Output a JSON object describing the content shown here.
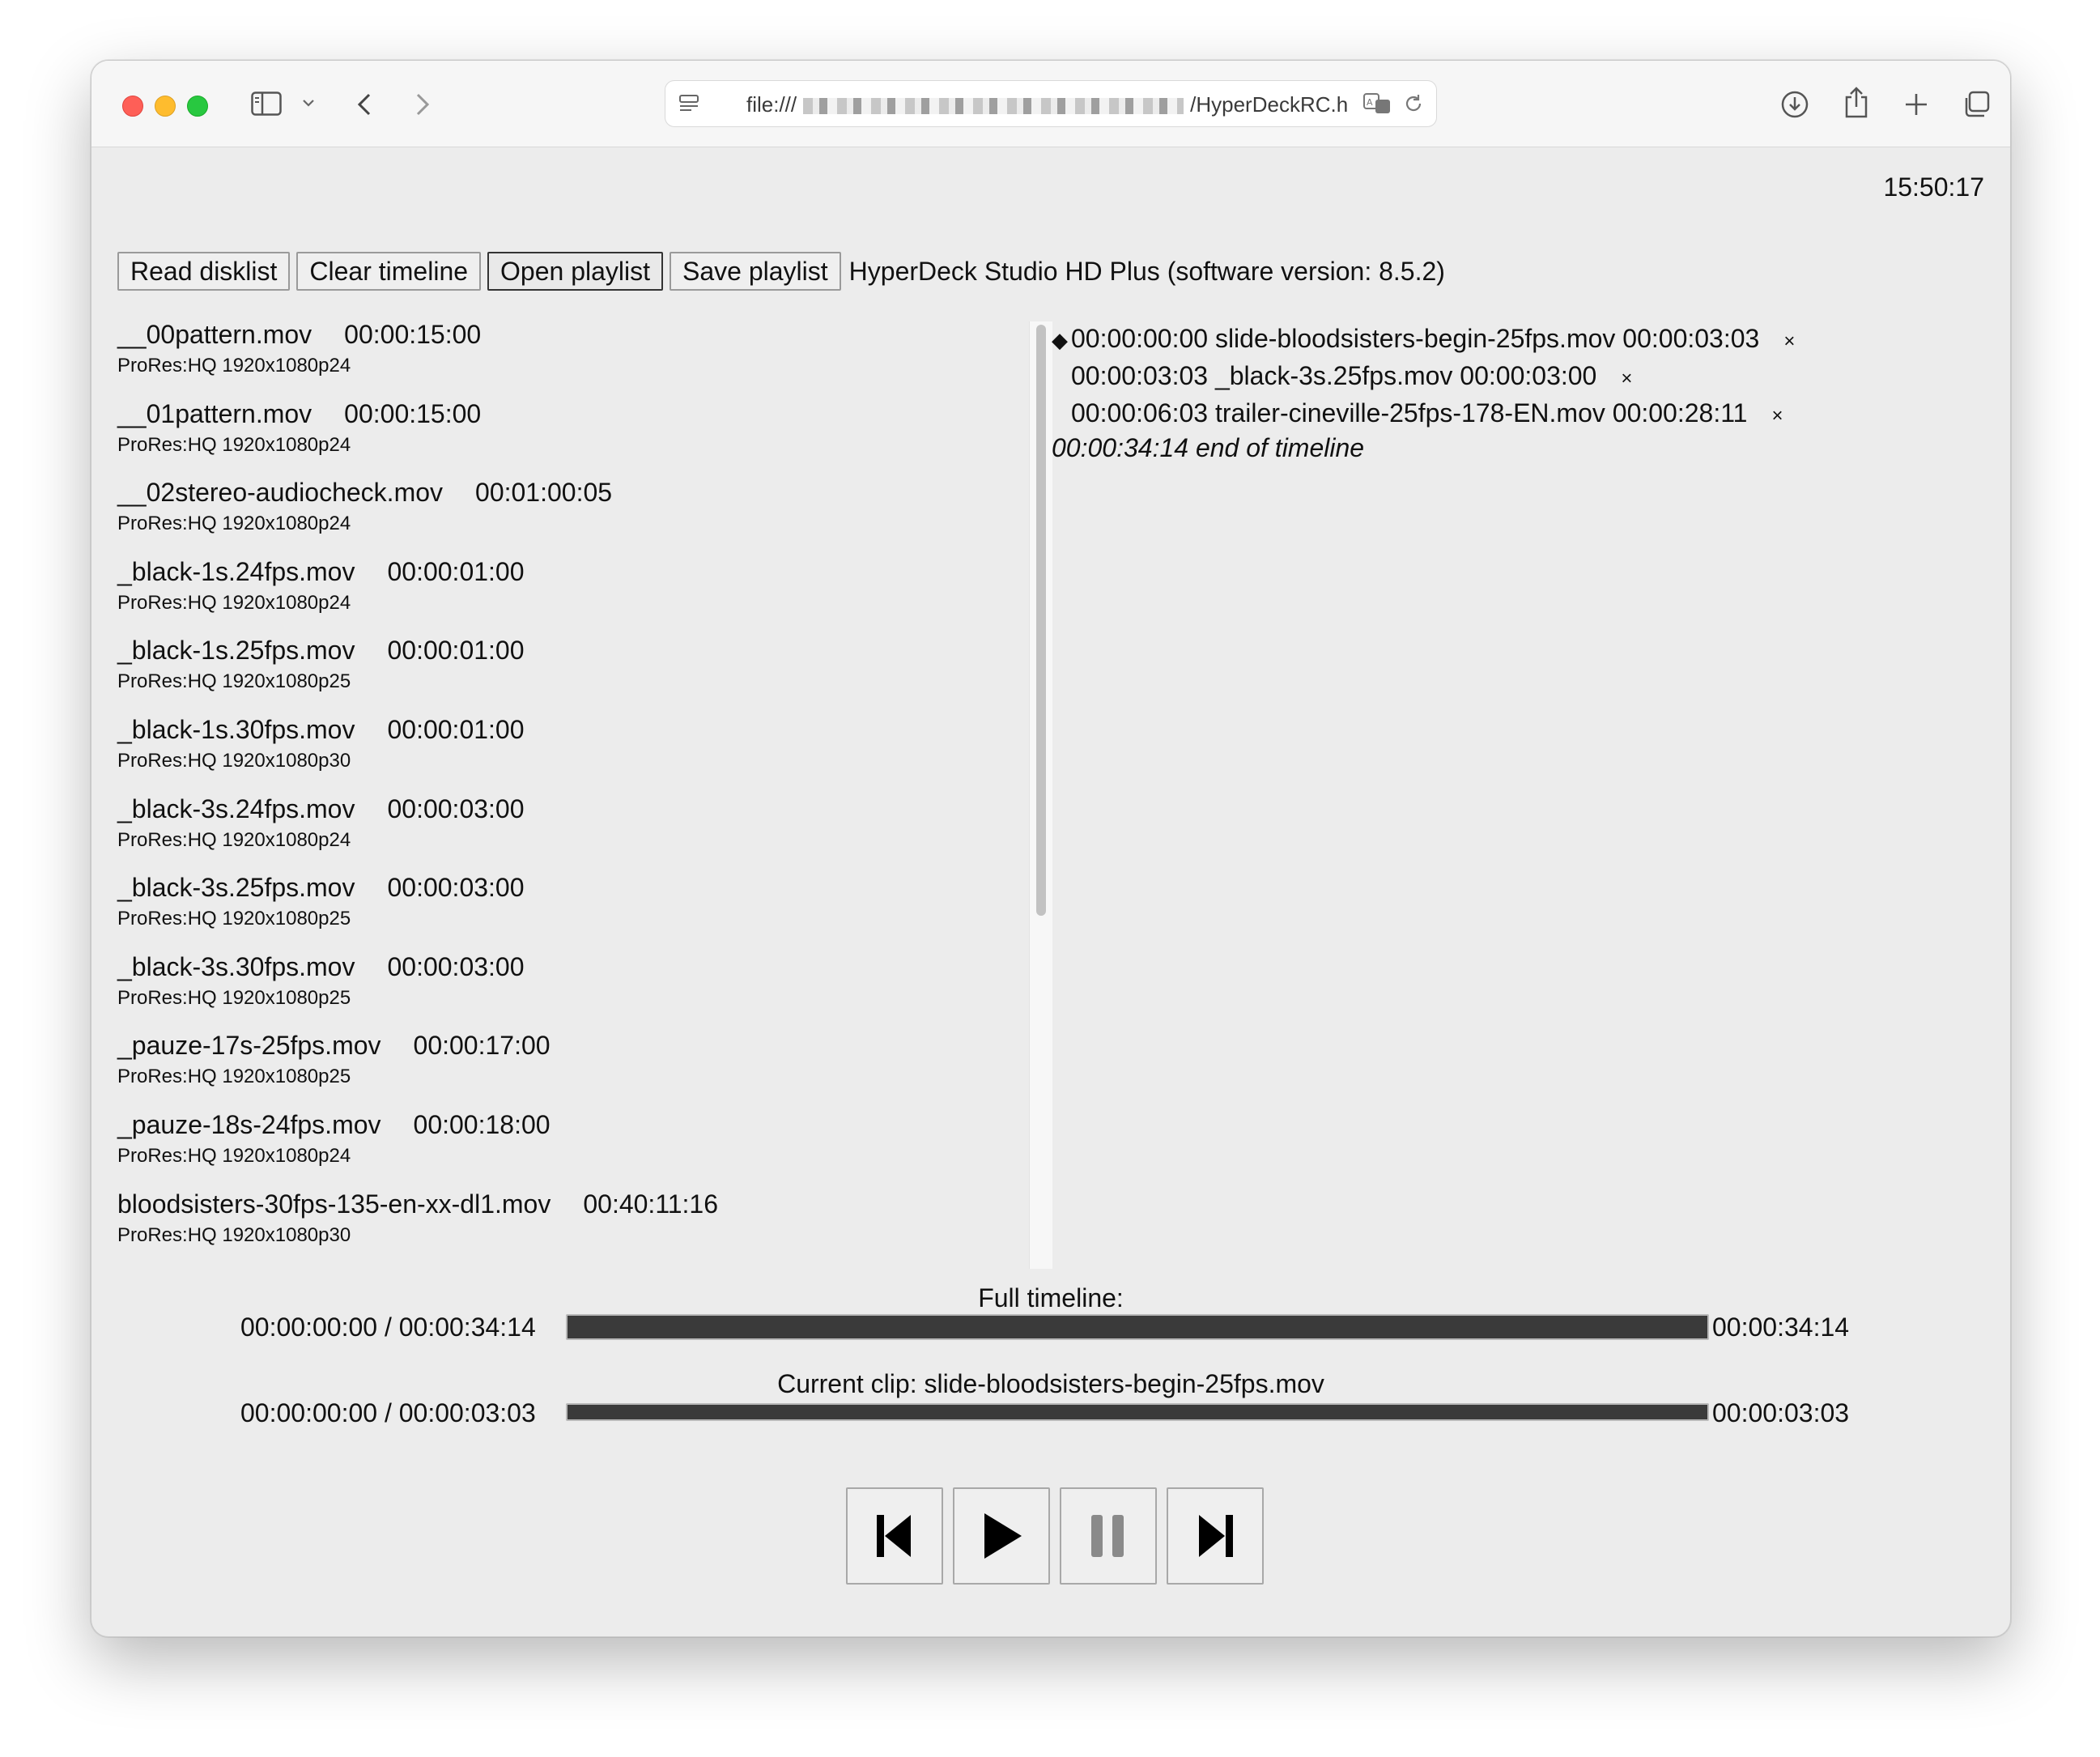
{
  "browser": {
    "url_prefix": "file:///",
    "url_suffix": "/HyperDeckRC.h",
    "icons": [
      "sidebar-icon",
      "chevron-down-icon",
      "back-icon",
      "forward-icon",
      "page-settings-icon",
      "translate-icon",
      "reload-icon",
      "download-icon",
      "share-icon",
      "new-tab-icon",
      "tab-overview-icon"
    ]
  },
  "clock": "15:50:17",
  "toolbar": {
    "read_disklist": "Read disklist",
    "clear_timeline": "Clear timeline",
    "open_playlist": "Open playlist",
    "save_playlist": "Save playlist",
    "device_info": "HyperDeck Studio HD Plus (software version: 8.5.2)"
  },
  "disklist": [
    {
      "name": "__00pattern.mov",
      "duration": "00:00:15:00",
      "format": "ProRes:HQ 1920x1080p24"
    },
    {
      "name": "__01pattern.mov",
      "duration": "00:00:15:00",
      "format": "ProRes:HQ 1920x1080p24"
    },
    {
      "name": "__02stereo-audiocheck.mov",
      "duration": "00:01:00:05",
      "format": "ProRes:HQ 1920x1080p24"
    },
    {
      "name": "_black-1s.24fps.mov",
      "duration": "00:00:01:00",
      "format": "ProRes:HQ 1920x1080p24"
    },
    {
      "name": "_black-1s.25fps.mov",
      "duration": "00:00:01:00",
      "format": "ProRes:HQ 1920x1080p25"
    },
    {
      "name": "_black-1s.30fps.mov",
      "duration": "00:00:01:00",
      "format": "ProRes:HQ 1920x1080p30"
    },
    {
      "name": "_black-3s.24fps.mov",
      "duration": "00:00:03:00",
      "format": "ProRes:HQ 1920x1080p24"
    },
    {
      "name": "_black-3s.25fps.mov",
      "duration": "00:00:03:00",
      "format": "ProRes:HQ 1920x1080p25"
    },
    {
      "name": "_black-3s.30fps.mov",
      "duration": "00:00:03:00",
      "format": "ProRes:HQ 1920x1080p25"
    },
    {
      "name": "_pauze-17s-25fps.mov",
      "duration": "00:00:17:00",
      "format": "ProRes:HQ 1920x1080p25"
    },
    {
      "name": "_pauze-18s-24fps.mov",
      "duration": "00:00:18:00",
      "format": "ProRes:HQ 1920x1080p24"
    },
    {
      "name": "bloodsisters-30fps-135-en-xx-dl1.mov",
      "duration": "00:40:11:16",
      "format": "ProRes:HQ 1920x1080p30"
    }
  ],
  "timeline": {
    "entries": [
      {
        "marker": "◆",
        "start": "00:00:00:00",
        "name": "slide-bloodsisters-begin-25fps.mov",
        "duration": "00:00:03:03",
        "remove": "×"
      },
      {
        "marker": "",
        "start": "00:00:03:03",
        "name": "_black-3s.25fps.mov",
        "duration": "00:00:03:00",
        "remove": "×"
      },
      {
        "marker": "",
        "start": "00:00:06:03",
        "name": "trailer-cineville-25fps-178-EN.mov",
        "duration": "00:00:28:11",
        "remove": "×"
      }
    ],
    "end_time": "00:00:34:14",
    "end_label": "end of timeline"
  },
  "full_timeline": {
    "label": "Full timeline:",
    "position": "00:00:00:00 / 00:00:34:14",
    "total": "00:00:34:14",
    "progress": 0
  },
  "current_clip": {
    "label": "Current clip: slide-bloodsisters-begin-25fps.mov",
    "position": "00:00:00:00 / 00:00:03:03",
    "total": "00:00:03:03",
    "progress": 0
  },
  "transport": {
    "icons": [
      "skip-previous-icon",
      "play-icon",
      "pause-icon",
      "skip-next-icon"
    ]
  }
}
